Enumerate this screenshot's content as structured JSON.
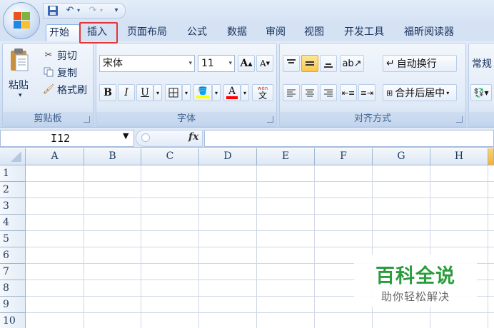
{
  "quick_access": {
    "save_icon": "save-icon",
    "undo_icon": "undo-icon",
    "redo_icon": "redo-icon",
    "customize_icon": "customize-qat-icon"
  },
  "tabs": [
    {
      "label": "开始",
      "active": true
    },
    {
      "label": "插入",
      "highlighted": true
    },
    {
      "label": "页面布局"
    },
    {
      "label": "公式"
    },
    {
      "label": "数据"
    },
    {
      "label": "审阅"
    },
    {
      "label": "视图"
    },
    {
      "label": "开发工具"
    },
    {
      "label": "福昕阅读器"
    }
  ],
  "clipboard": {
    "group_label": "剪贴板",
    "paste_label": "粘贴",
    "cut_label": "剪切",
    "copy_label": "复制",
    "format_painter_label": "格式刷"
  },
  "font": {
    "group_label": "字体",
    "font_name": "宋体",
    "font_size": "11",
    "grow_label": "A",
    "shrink_label": "A",
    "bold": "B",
    "italic": "I",
    "underline": "U",
    "font_color_label": "A",
    "phonetic_label": "wén"
  },
  "alignment": {
    "group_label": "对齐方式",
    "wrap_text_label": "自动换行",
    "merge_center_label": "合并后居中"
  },
  "number": {
    "format_label": "常规"
  },
  "formula_bar": {
    "name_box": "I12",
    "fx": "fx",
    "formula": ""
  },
  "columns": [
    "A",
    "B",
    "C",
    "D",
    "E",
    "F",
    "G",
    "H"
  ],
  "rows": [
    "1",
    "2",
    "3",
    "4",
    "5",
    "6",
    "7",
    "8",
    "9",
    "10"
  ],
  "watermark": {
    "title": "百科全说",
    "subtitle": "助你轻松解决"
  },
  "colors": {
    "highlight_box": "#e03535",
    "fill_color_bar": "#ffff00",
    "font_color_bar": "#ff0000",
    "selected_column_header": "#f4b13b",
    "watermark_green": "#2b9c3c"
  }
}
